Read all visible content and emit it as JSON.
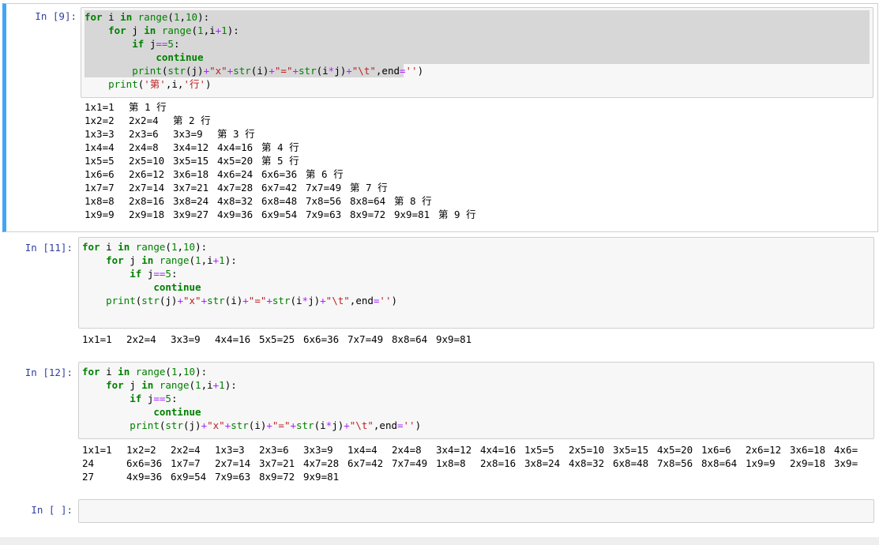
{
  "cells": [
    {
      "prompt": "In  [9]:",
      "code": [
        "for i in range(1,10):",
        "    for j in range(1,i+1):",
        "        if j==5:",
        "            continue",
        "        print(str(j)+\"x\"+str(i)+\"=\"+str(i*j)+\"\\t\",end='')",
        "    print('第',i,'行')"
      ],
      "output": [
        [
          "1x1=1",
          "第 1 行"
        ],
        [
          "1x2=2",
          "2x2=4",
          "第 2 行"
        ],
        [
          "1x3=3",
          "2x3=6",
          "3x3=9",
          "第 3 行"
        ],
        [
          "1x4=4",
          "2x4=8",
          "3x4=12",
          "4x4=16",
          "第 4 行"
        ],
        [
          "1x5=5",
          "2x5=10",
          "3x5=15",
          "4x5=20",
          "第 5 行"
        ],
        [
          "1x6=6",
          "2x6=12",
          "3x6=18",
          "4x6=24",
          "6x6=36",
          "第 6 行"
        ],
        [
          "1x7=7",
          "2x7=14",
          "3x7=21",
          "4x7=28",
          "6x7=42",
          "7x7=49",
          "第 7 行"
        ],
        [
          "1x8=8",
          "2x8=16",
          "3x8=24",
          "4x8=32",
          "6x8=48",
          "7x8=56",
          "8x8=64",
          "第 8 行"
        ],
        [
          "1x9=9",
          "2x9=18",
          "3x9=27",
          "4x9=36",
          "6x9=54",
          "7x9=63",
          "8x9=72",
          "9x9=81",
          "第 9 行"
        ]
      ]
    },
    {
      "prompt": "In  [11]:",
      "code": [
        "for i in range(1,10):",
        "    for j in range(1,i+1):",
        "        if j==5:",
        "            continue",
        "    print(str(j)+\"x\"+str(i)+\"=\"+str(i*j)+\"\\t\",end='')"
      ],
      "output": [
        [
          "1x1=1",
          "2x2=4",
          "3x3=9",
          "4x4=16",
          "5x5=25",
          "6x6=36",
          "7x7=49",
          "8x8=64",
          "9x9=81"
        ]
      ]
    },
    {
      "prompt": "In  [12]:",
      "code": [
        "for i in range(1,10):",
        "    for j in range(1,i+1):",
        "        if j==5:",
        "            continue",
        "        print(str(j)+\"x\"+str(i)+\"=\"+str(i*j)+\"\\t\",end='')"
      ],
      "output": [
        [
          "1x1=1",
          "1x2=2",
          "2x2=4",
          "1x3=3",
          "2x3=6",
          "3x3=9",
          "1x4=4",
          "2x4=8",
          "3x4=12",
          "4x4=16",
          "1x5=5",
          "2x5=10",
          "3x5=15",
          "4x5=20",
          "1x6=6",
          "2x6=12",
          "3x6=18",
          "4x6="
        ],
        [
          "24",
          "6x6=36",
          "1x7=7",
          "2x7=14",
          "3x7=21",
          "4x7=28",
          "6x7=42",
          "7x7=49",
          "1x8=8",
          "2x8=16",
          "3x8=24",
          "4x8=32",
          "6x8=48",
          "7x8=56",
          "8x8=64",
          "1x9=9",
          "2x9=18",
          "3x9="
        ],
        [
          "27",
          "4x9=36",
          "6x9=54",
          "7x9=63",
          "8x9=72",
          "9x9=81"
        ]
      ]
    },
    {
      "prompt": "In  [ ]:",
      "code": [],
      "output": []
    }
  ],
  "colors": {
    "keyword": "#008000",
    "operator": "#aa22ff",
    "string": "#ba2121",
    "prompt": "#303f9f",
    "selected_bar": "#42a5f5"
  }
}
